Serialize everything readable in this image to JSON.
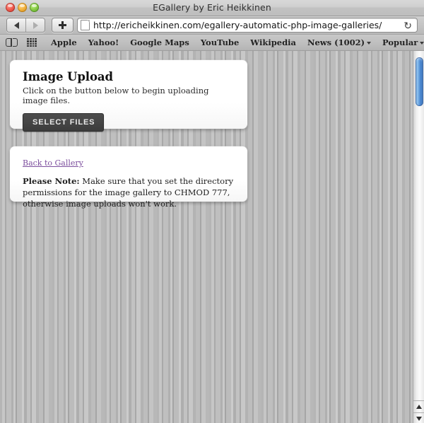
{
  "window": {
    "title": "EGallery by Eric Heikkinen",
    "traffic_lights": [
      "close",
      "minimize",
      "zoom"
    ]
  },
  "toolbar": {
    "back_label": "Back",
    "forward_label": "Forward",
    "new_tab_label": "+",
    "reload_icon": "↻",
    "url": "http://ericheikkinen.com/egallery-automatic-php-image-galleries/"
  },
  "bookmarks": {
    "icons": [
      "book-icon",
      "grid-icon"
    ],
    "items": [
      {
        "label": "Apple",
        "has_caret": false
      },
      {
        "label": "Yahoo!",
        "has_caret": false
      },
      {
        "label": "Google Maps",
        "has_caret": false
      },
      {
        "label": "YouTube",
        "has_caret": false
      },
      {
        "label": "Wikipedia",
        "has_caret": false
      },
      {
        "label": "News (1002)",
        "has_caret": true
      },
      {
        "label": "Popular",
        "has_caret": true
      }
    ]
  },
  "page": {
    "upload_card": {
      "title": "Image Upload",
      "subtitle": "Click on the button below to begin uploading image files.",
      "button_label": "SELECT FILES"
    },
    "note_card": {
      "link_label": "Back to Gallery",
      "note_label": "Please Note:",
      "note_body": " Make sure that you set the directory permissions for the image gallery to CHMOD 777, otherwise image uploads won't work."
    }
  },
  "scrollbar": {
    "thumb_position_percent": 2,
    "thumb_size_percent": 13
  },
  "colors": {
    "button_background": "#454545",
    "link_visited": "#7d4f9e",
    "scroll_thumb": "#4e8ad2",
    "card_background": "#ffffff"
  }
}
